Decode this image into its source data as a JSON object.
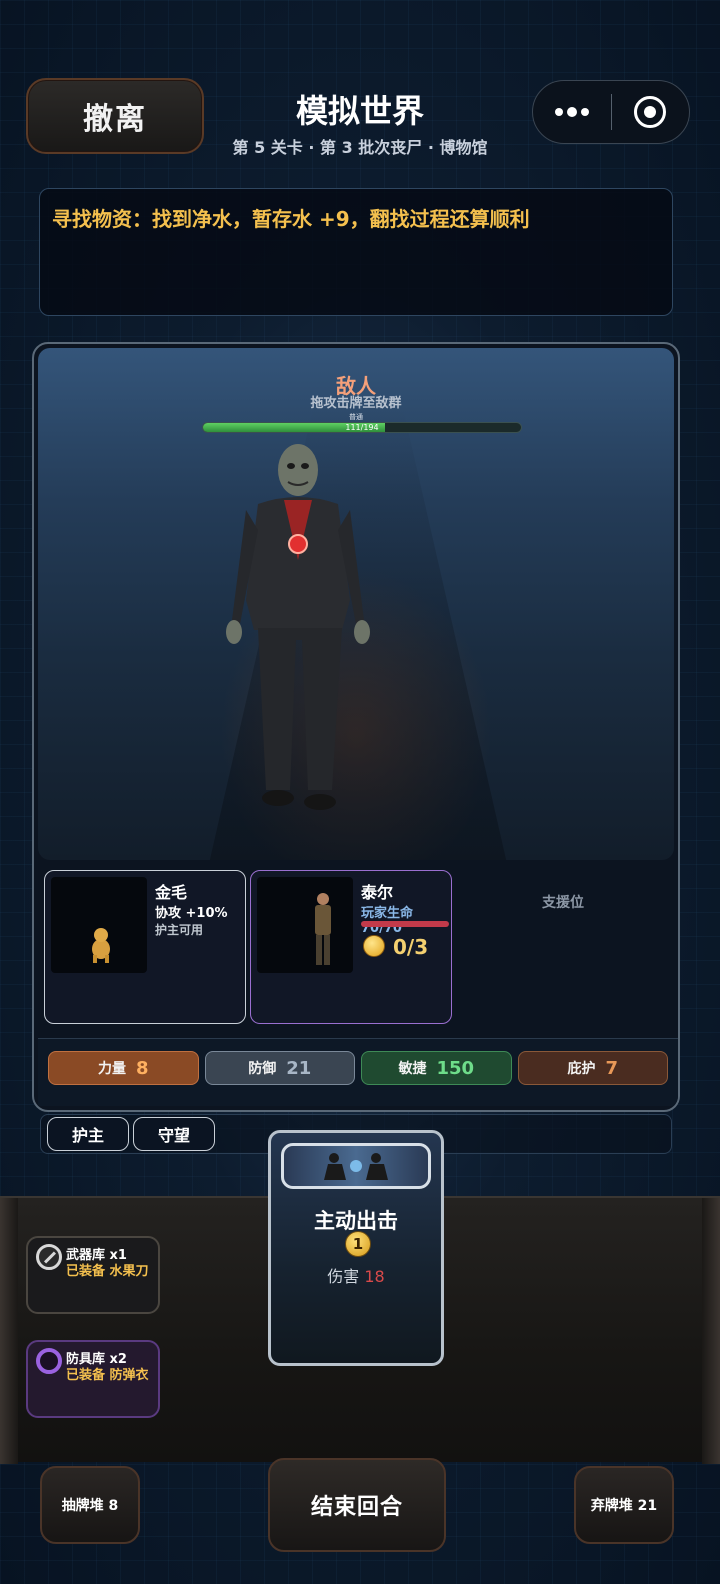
{
  "header": {
    "retreat_label": "撤离",
    "title": "模拟世界",
    "subtitle": "第 5 关卡 · 第 3 批次丧尸 · 博物馆"
  },
  "message": "寻找物资：找到净水，暂存水 +9，翻找过程还算顺利",
  "enemy": {
    "title": "敌人",
    "hint": "拖攻击牌至敌群",
    "type_tag": "普通",
    "hp_current": 111,
    "hp_max": 194,
    "hp_text": "111/194"
  },
  "allies": [
    {
      "name": "金毛",
      "line1": "协攻 +10%",
      "line2": "护主可用"
    },
    {
      "name": "泰尔",
      "line1": "玩家生命 70/70",
      "coins": "0/3"
    }
  ],
  "support_label": "支援位",
  "stats": [
    {
      "label": "力量",
      "value": "8"
    },
    {
      "label": "防御",
      "value": "21"
    },
    {
      "label": "敏捷",
      "value": "150"
    },
    {
      "label": "庇护",
      "value": "7"
    }
  ],
  "tags": [
    "护主",
    "守望"
  ],
  "inventory": {
    "weapon": {
      "title": "武器库 x1",
      "equipped": "已装备 水果刀"
    },
    "armor": {
      "title": "防具库 x2",
      "equipped": "已装备 防弹衣"
    }
  },
  "action_card": {
    "name": "主动出击",
    "cost": "1",
    "damage_label": "伤害",
    "damage_value": "18"
  },
  "footer": {
    "draw_pile": "抽牌堆 8",
    "end_turn": "结束回合",
    "discard_pile": "弃牌堆 21"
  },
  "colors": {
    "accent_gold": "#f4c04e",
    "enemy_title": "#f4a07a",
    "hp_green": "#4fbf55",
    "player_hp_red": "#c23a4a"
  }
}
